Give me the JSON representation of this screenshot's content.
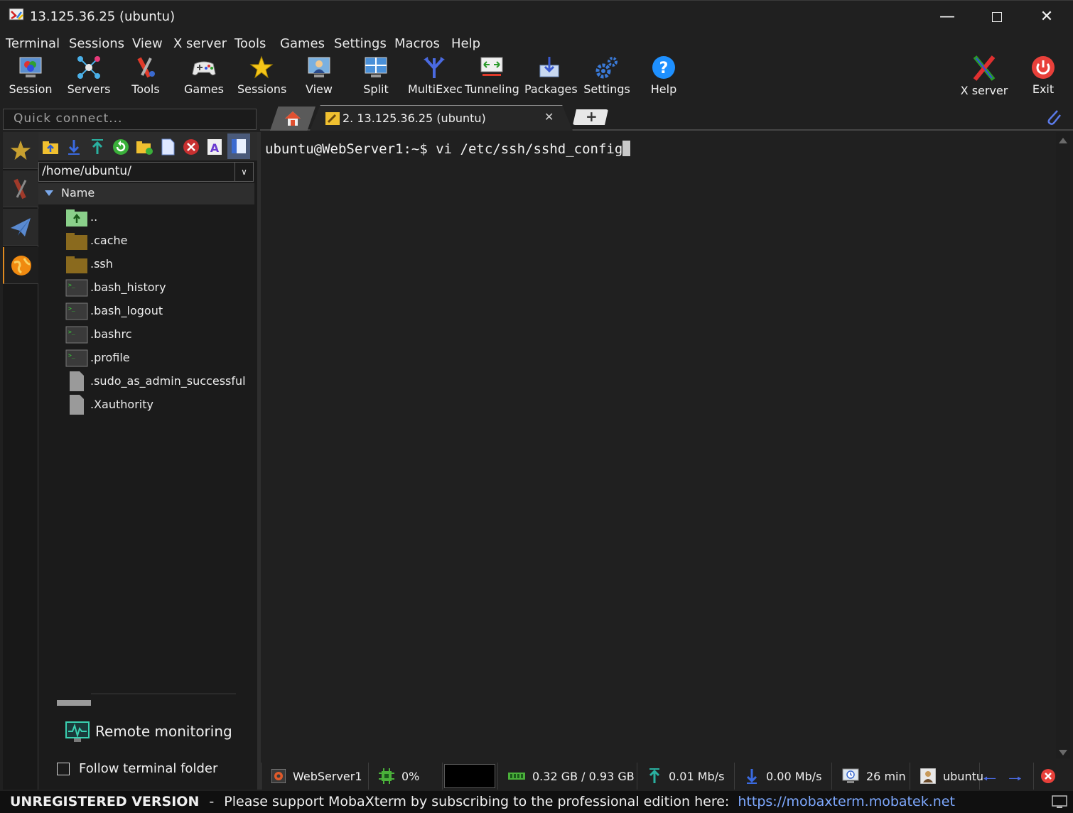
{
  "window": {
    "title": "13.125.36.25 (ubuntu)"
  },
  "menu": [
    "Terminal",
    "Sessions",
    "View",
    "X server",
    "Tools",
    "Games",
    "Settings",
    "Macros",
    "Help"
  ],
  "toolbar": {
    "session": "Session",
    "servers": "Servers",
    "tools": "Tools",
    "games": "Games",
    "sessions": "Sessions",
    "view": "View",
    "split": "Split",
    "multiexec": "MultiExec",
    "tunneling": "Tunneling",
    "packages": "Packages",
    "settings": "Settings",
    "help": "Help",
    "xserver": "X server",
    "exit": "Exit"
  },
  "quick_connect": {
    "placeholder": "Quick connect..."
  },
  "tabs": {
    "active_label": "2. 13.125.36.25 (ubuntu)"
  },
  "file_browser": {
    "path": "/home/ubuntu/",
    "column": "Name",
    "files": [
      {
        "name": "..",
        "type": "parent"
      },
      {
        "name": ".cache",
        "type": "folder"
      },
      {
        "name": ".ssh",
        "type": "folder"
      },
      {
        "name": ".bash_history",
        "type": "script"
      },
      {
        "name": ".bash_logout",
        "type": "script"
      },
      {
        "name": ".bashrc",
        "type": "script"
      },
      {
        "name": ".profile",
        "type": "script"
      },
      {
        "name": ".sudo_as_admin_successful",
        "type": "file"
      },
      {
        "name": ".Xauthority",
        "type": "file"
      }
    ],
    "remote_monitoring": "Remote monitoring",
    "follow_terminal": "Follow terminal folder"
  },
  "terminal": {
    "line": "ubuntu@WebServer1:~$ vi /etc/ssh/sshd_config"
  },
  "status": {
    "host": "WebServer1",
    "cpu": "0%",
    "memory": "0.32 GB / 0.93 GB",
    "upload": "0.01 Mb/s",
    "download": "0.00 Mb/s",
    "uptime": "26 min",
    "user": "ubuntu"
  },
  "footer": {
    "unregistered": "UNREGISTERED VERSION",
    "sep": "-",
    "message": "Please support MobaXterm by subscribing to the professional edition here:",
    "link": "https://mobaxterm.mobatek.net"
  },
  "colors": {
    "background": "#202020",
    "link": "#7ea9ff",
    "folder": "#8a6a1e",
    "exit_red": "#e8403a"
  }
}
